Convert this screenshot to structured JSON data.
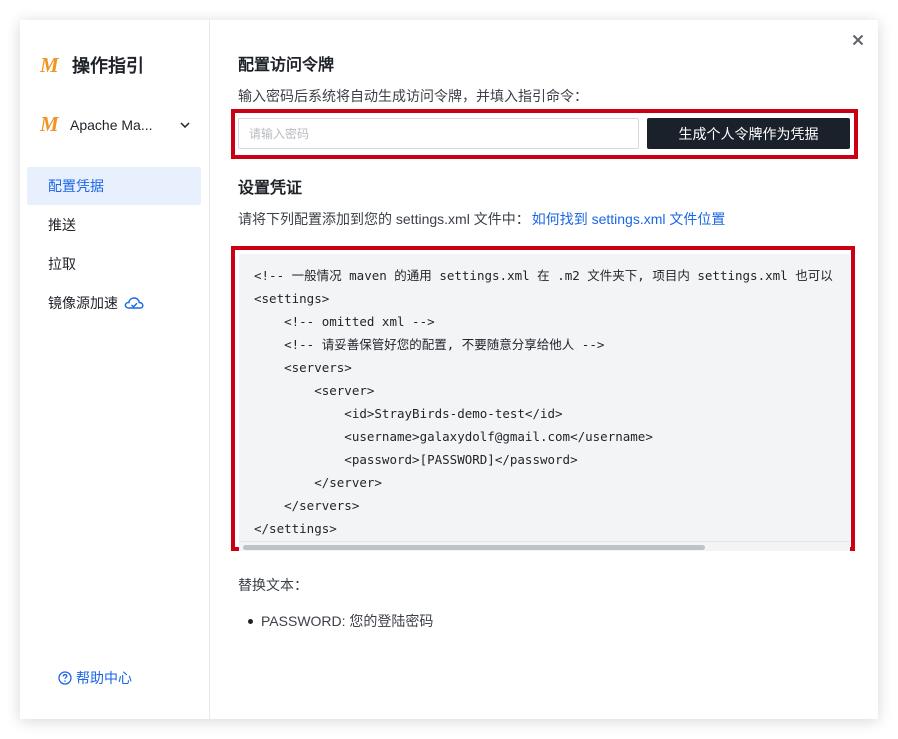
{
  "sidebar": {
    "logo_letter": "M",
    "title": "操作指引",
    "repo": {
      "name": "Apache Ma...",
      "logo_letter": "M"
    },
    "nav": [
      {
        "label": "配置凭据",
        "active": true
      },
      {
        "label": "推送",
        "active": false
      },
      {
        "label": "拉取",
        "active": false
      },
      {
        "label": "镜像源加速",
        "active": false,
        "icon": "cloud-icon"
      }
    ],
    "help_label": "帮助中心"
  },
  "main": {
    "token_section": {
      "title": "配置访问令牌",
      "description": "输入密码后系统将自动生成访问令牌，并填入指引命令：",
      "password_placeholder": "请输入密码",
      "password_value": "",
      "generate_button": "生成个人令牌作为凭据"
    },
    "credential_section": {
      "title": "设置凭证",
      "description": "请将下列配置添加到您的 settings.xml 文件中：",
      "link": "如何找到 settings.xml 文件位置",
      "code": "<!-- 一般情况 maven 的通用 settings.xml 在 .m2 文件夹下, 项目内 settings.xml 也可以\n<settings>\n    <!-- omitted xml -->\n    <!-- 请妥善保管好您的配置, 不要随意分享给他人 -->\n    <servers>\n        <server>\n            <id>StrayBirds-demo-test</id>\n            <username>galaxydolf@gmail.com</username>\n            <password>[PASSWORD]</password>\n        </server>\n    </servers>\n</settings>",
      "replace_title": "替换文本：",
      "replacements": [
        "PASSWORD: 您的登陆密码"
      ]
    }
  },
  "colors": {
    "accent": "#1a66e6",
    "logo": "#f29423",
    "highlight_border": "#cc0013",
    "primary_button": "#1b212b"
  }
}
